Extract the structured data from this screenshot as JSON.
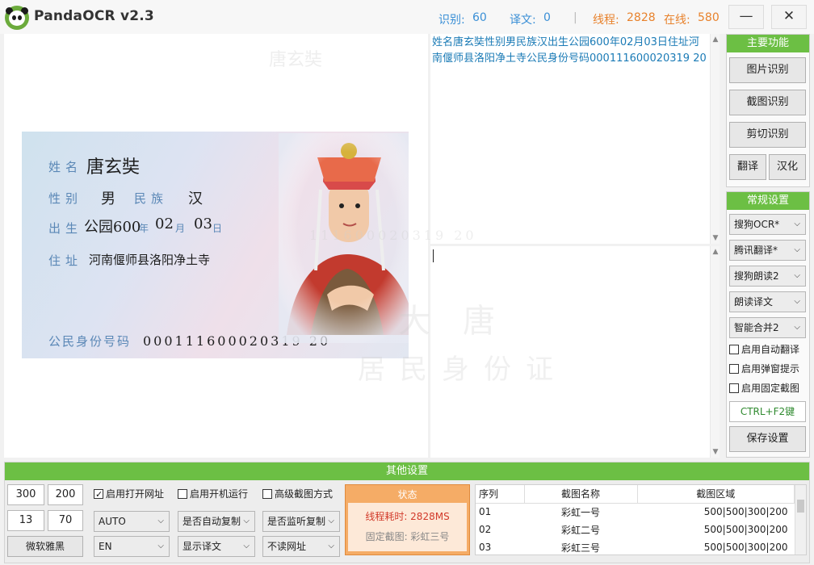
{
  "app": {
    "title": "PandaOCR v2.3",
    "stats": {
      "recognize_label": "识别:",
      "recognize_value": "60",
      "translate_label": "译文:",
      "translate_value": "0",
      "separator": "|",
      "threads_label": "线程:",
      "threads_value": "2828",
      "online_label": "在线:",
      "online_value": "580"
    },
    "minimize": "—",
    "close": "✕"
  },
  "colors": {
    "accent_green": "#6cbf44",
    "stat_blue": "#3a8fd6",
    "stat_orange": "#e8822c",
    "status_orange": "#f5ac66"
  },
  "id_card": {
    "name_label": "姓名",
    "name_value": "唐玄奘",
    "gender_label": "性别",
    "gender_value": "男",
    "ethnicity_label": "民族",
    "ethnicity_value": "汉",
    "birth_label": "出生",
    "birth_year": "公园600",
    "year_char": "年",
    "birth_month": "02",
    "month_char": "月",
    "birth_day": "03",
    "day_char": "日",
    "address_label": "住址",
    "address_value": "河南偃师县洛阳净土寺",
    "id_label": "公民身份号码",
    "id_value": "000111600020319 20"
  },
  "ocr_result": {
    "line1": "姓名唐玄奘性别男民族汉出生公园600年02月03日住址河",
    "line2": "南偃师县洛阳净土寺公民身份号码000111600020319 20"
  },
  "main_functions": {
    "header": "主要功能",
    "image_ocr": "图片识别",
    "screenshot_ocr": "截图识别",
    "clipboard_ocr": "剪切识别",
    "translate": "翻译",
    "localize": "汉化"
  },
  "settings": {
    "header": "常规设置",
    "ocr_engine": "搜狗OCR*",
    "translator": "腾讯翻译*",
    "reader": "搜狗朗读2",
    "read_target": "朗读译文",
    "merge_mode": "智能合并2",
    "auto_translate": "启用自动翻译",
    "popup_hint": "启用弹窗提示",
    "fixed_capture": "启用固定截图",
    "hotkey": "CTRL+F2键",
    "save": "保存设置"
  },
  "other_settings": {
    "header": "其他设置",
    "width": "300",
    "height": "200",
    "x": "13",
    "y": "70",
    "font": "微软雅黑",
    "open_url": "启用打开网址",
    "open_url_checked": true,
    "autostart": "启用开机运行",
    "autostart_checked": false,
    "advanced_capture": "高级截图方式",
    "advanced_capture_checked": false,
    "source_lang": "AUTO",
    "target_lang": "EN",
    "auto_copy": "是否自动复制",
    "display_mode": "显示译文",
    "monitor_copy": "是否监听复制",
    "url_mode": "不读网址"
  },
  "status": {
    "header": "状态",
    "elapsed": "线程耗时: 2828MS",
    "fixed": "固定截图: 彩虹三号"
  },
  "capture_table": {
    "columns": [
      "序列",
      "截图名称",
      "截图区域"
    ],
    "rows": [
      [
        "01",
        "彩虹一号",
        "500|500|300|200"
      ],
      [
        "02",
        "彩虹二号",
        "500|500|300|200"
      ],
      [
        "03",
        "彩虹三号",
        "500|500|300|200"
      ]
    ]
  }
}
